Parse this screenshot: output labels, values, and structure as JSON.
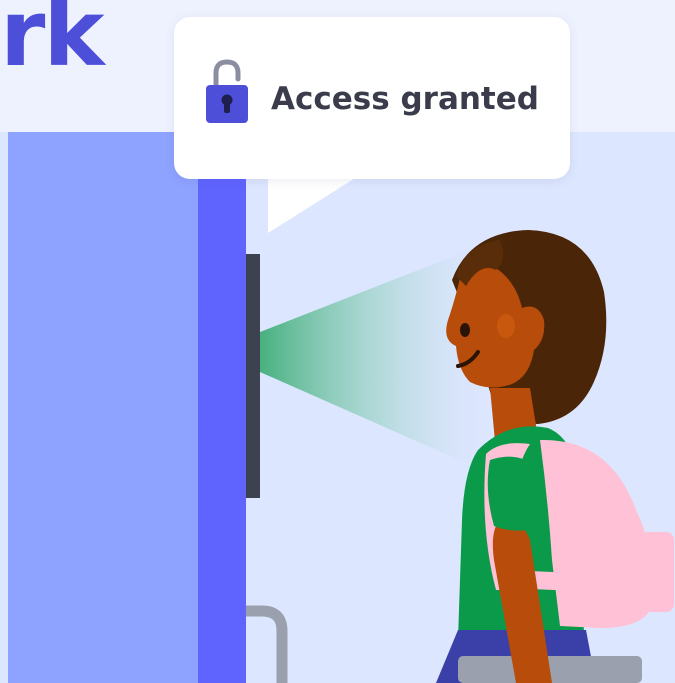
{
  "headline": {
    "text": "rk"
  },
  "notification": {
    "message": "Access granted",
    "icon": "unlocked-padlock-icon"
  },
  "colors": {
    "brand": "#4e4fd9",
    "door": "#6064ff",
    "wall": "#8ea2ff",
    "scanner_beam": "#3fae78",
    "bubble_text": "#3a3c4c"
  },
  "illustration": {
    "scene": "face-recognition-door-scanner",
    "person": "student-with-backpack"
  }
}
